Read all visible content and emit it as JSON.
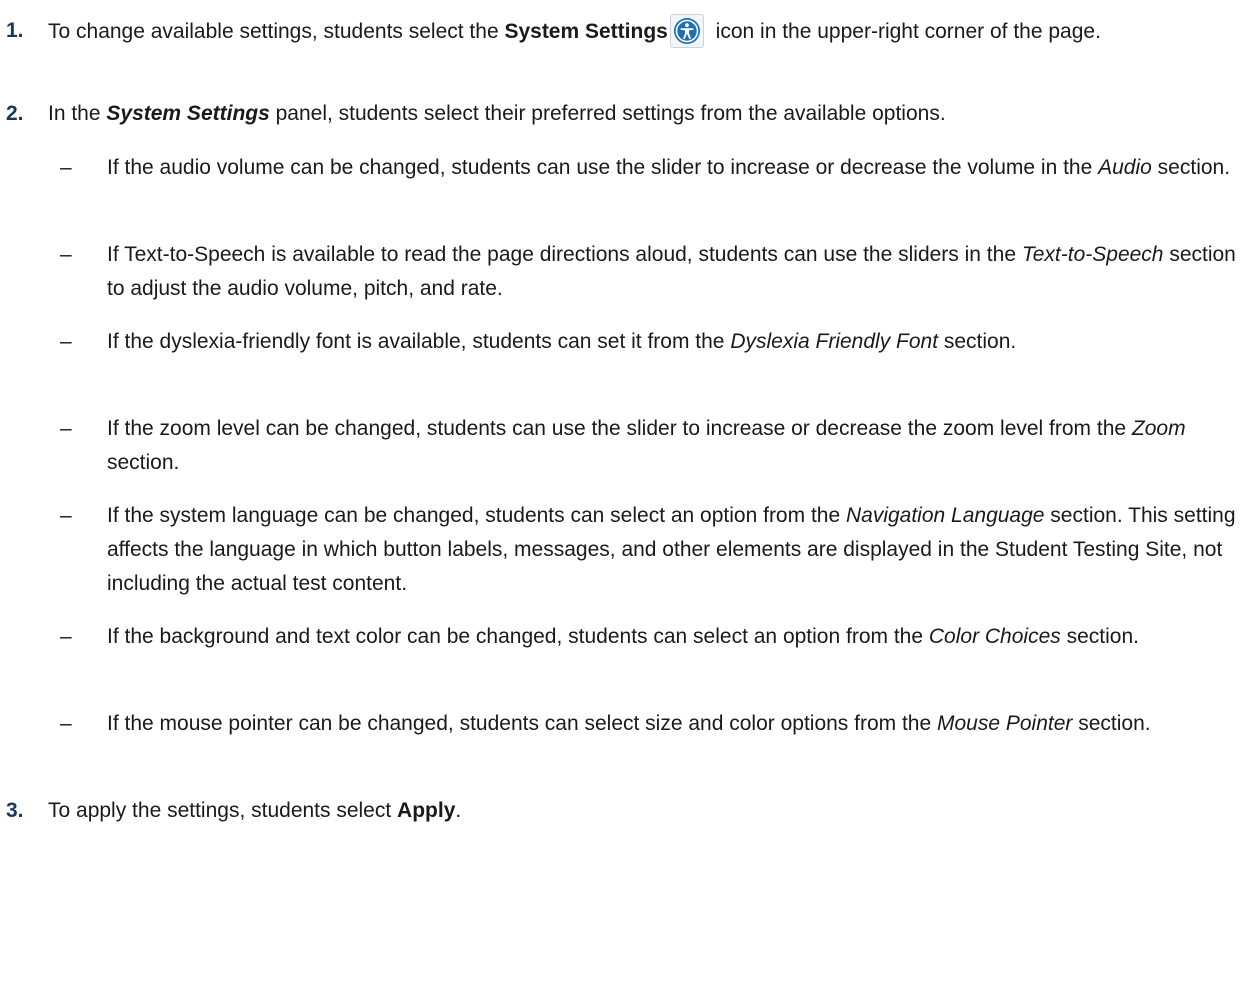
{
  "steps": [
    {
      "number": "1.",
      "before": "To change available settings, students select the ",
      "bold": "System Settings",
      "icon": "accessibility-icon",
      "after": " icon in the upper-right corner of the page."
    },
    {
      "number": "2.",
      "before": "In the ",
      "bold_italic": "System Settings",
      "after": " panel, students select their preferred settings from the available options."
    },
    {
      "number": "3.",
      "before": "To apply the settings, students select ",
      "bold": "Apply",
      "after": "."
    }
  ],
  "bullets": [
    {
      "dash": "–",
      "before": "If the audio volume can be changed, students can use the slider to increase or decrease the volume in the ",
      "italic": "Audio",
      "after": " section."
    },
    {
      "dash": "–",
      "before": "If Text-to-Speech is available to read the page directions aloud, students can use the sliders in the ",
      "italic": "Text-to-Speech",
      "after": " section to adjust the audio volume, pitch, and rate."
    },
    {
      "dash": "–",
      "before": "If the dyslexia-friendly font is available, students can set it from the ",
      "italic": "Dyslexia Friendly Font",
      "after": " section."
    },
    {
      "dash": "–",
      "before": "If the zoom level can be changed, students can use the slider to increase or decrease the zoom level from the ",
      "italic": "Zoom",
      "after": " section."
    },
    {
      "dash": "–",
      "before": "If the system language can be changed, students can select an option from the ",
      "italic": "Navigation Language",
      "after": " section. This setting affects the language in which button labels, messages, and other elements are displayed in the Student Testing Site, not including the actual test content."
    },
    {
      "dash": "–",
      "before": "If the background and text color can be changed, students can select an option from the ",
      "italic": "Color Choices",
      "after": " section."
    },
    {
      "dash": "–",
      "before": "If the mouse pointer can be changed, students can select size and color options from the ",
      "italic": "Mouse Pointer",
      "after": " section."
    }
  ],
  "colors": {
    "step_number": "#17375e",
    "icon_blue": "#1f6fb5",
    "text": "#1a1a1a"
  }
}
